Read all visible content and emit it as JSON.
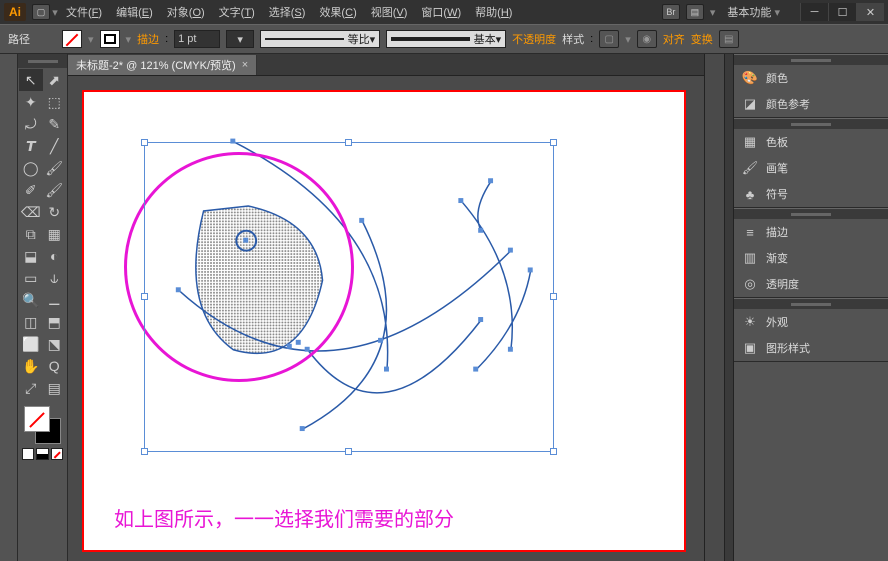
{
  "app": {
    "logo": "Ai"
  },
  "menu": [
    {
      "key": "F",
      "txt": "文件"
    },
    {
      "key": "E",
      "txt": "编辑"
    },
    {
      "key": "O",
      "txt": "对象"
    },
    {
      "key": "T",
      "txt": "文字"
    },
    {
      "key": "S",
      "txt": "选择"
    },
    {
      "key": "C",
      "txt": "效果"
    },
    {
      "key": "V",
      "txt": "视图"
    },
    {
      "key": "W",
      "txt": "窗口"
    },
    {
      "key": "H",
      "txt": "帮助"
    }
  ],
  "workspace": "基本功能",
  "control": {
    "kind": "路径",
    "stroke_label": "描边",
    "stroke_value": "1 pt",
    "uniform_label": "等比",
    "basic_label": "基本",
    "opacity_label": "不透明度",
    "style_label": "样式",
    "align_label": "对齐",
    "transform_label": "变换"
  },
  "doc_tab": "未标题-2* @ 121% (CMYK/预览)",
  "canvas": {
    "caption": "如上图所示，一一选择我们需要的部分"
  },
  "tools": [
    "↖",
    "⬈",
    "✦",
    "⬚",
    "⤾",
    "✎",
    "𝙏",
    "╱",
    "◯",
    "🖌",
    "✐",
    "🖌",
    "⌫",
    "↻",
    "⧉",
    "▦",
    "⬓",
    "◐",
    "▭",
    "⫝",
    "🔍",
    "⚊",
    "◫",
    "⬒",
    "⬜",
    "⬔",
    "✋",
    "Q",
    "⤢",
    "▤"
  ],
  "panels": [
    [
      {
        "icon": "🎨",
        "label": "颜色"
      },
      {
        "icon": "◪",
        "label": "颜色参考"
      }
    ],
    [
      {
        "icon": "▦",
        "label": "色板"
      },
      {
        "icon": "🖌",
        "label": "画笔"
      },
      {
        "icon": "♣",
        "label": "符号"
      }
    ],
    [
      {
        "icon": "≡",
        "label": "描边"
      },
      {
        "icon": "▥",
        "label": "渐变"
      },
      {
        "icon": "◎",
        "label": "透明度"
      }
    ],
    [
      {
        "icon": "☀",
        "label": "外观"
      },
      {
        "icon": "▣",
        "label": "图形样式"
      }
    ]
  ]
}
